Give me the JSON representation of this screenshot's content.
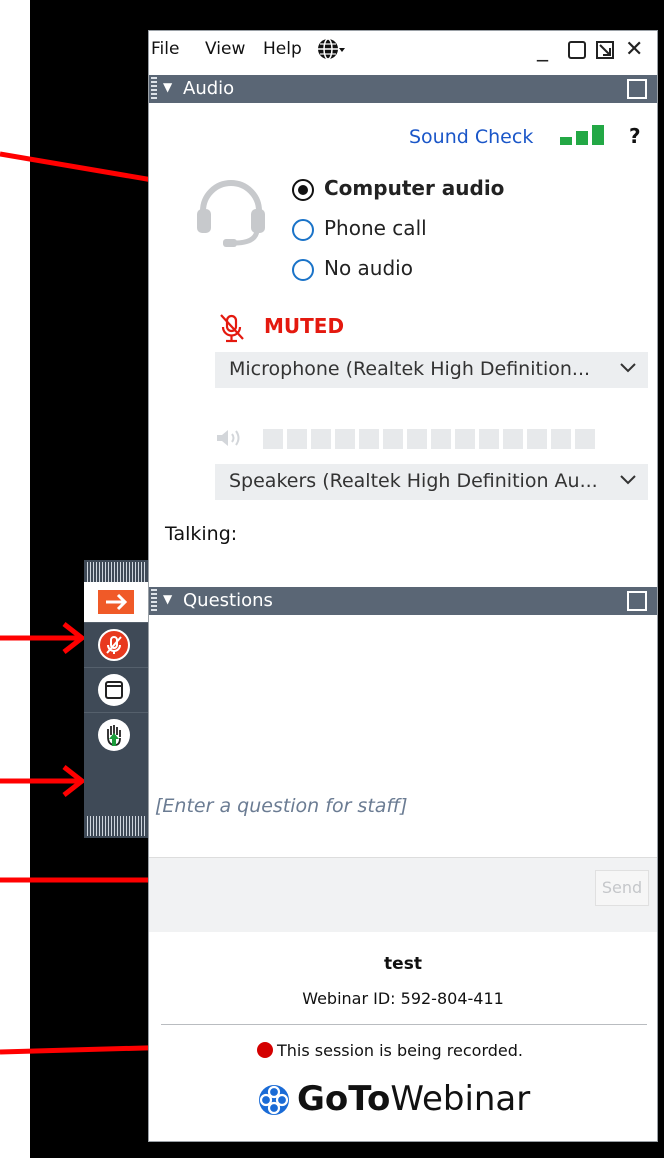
{
  "menu": {
    "file": "File",
    "view": "View",
    "help": "Help"
  },
  "window_controls": {
    "minimize": "_",
    "close": "✕"
  },
  "audio": {
    "header": "Audio",
    "sound_check": "Sound Check",
    "help_mark": "?",
    "options": [
      {
        "label": "Computer audio",
        "selected": true
      },
      {
        "label": "Phone call",
        "selected": false
      },
      {
        "label": "No audio",
        "selected": false
      }
    ],
    "muted_label": "MUTED",
    "microphone": "Microphone (Realtek High Definition...",
    "speakers": "Speakers (Realtek High Definition Au...",
    "talking_label": "Talking:"
  },
  "questions": {
    "header": "Questions",
    "placeholder": "[Enter a question for staff]",
    "send_label": "Send"
  },
  "session": {
    "title": "test",
    "webinar_id": "Webinar ID: 592-804-411",
    "recording_notice": "This session is being recorded."
  },
  "brand": {
    "goto": "GoTo",
    "webinar": "Webinar"
  },
  "colors": {
    "header_bg": "#5a6675",
    "muted_red": "#e4190f",
    "link_blue": "#1a56c8",
    "toolbar_bg": "#3f4a57",
    "mic_button": "#e8391e",
    "orange_arrow": "#f05a28",
    "arrow_red": "#ff0000"
  },
  "icons": [
    "globe-icon",
    "headset-icon",
    "muted-microphone-icon",
    "speaker-icon",
    "chevron-down-icon",
    "signal-bars-icon",
    "popout-icon",
    "collapse-arrow-icon",
    "microphone-button-icon",
    "window-icon",
    "raise-hand-icon",
    "gotowebinar-logo-icon"
  ]
}
